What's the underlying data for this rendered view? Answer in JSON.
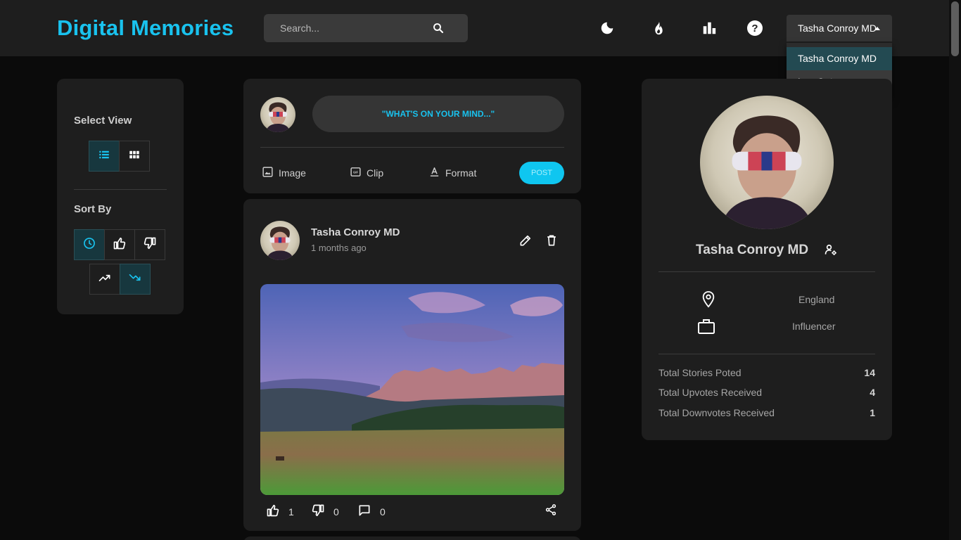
{
  "header": {
    "logo": "Digital Memories",
    "search_placeholder": "Search...",
    "icons": [
      "moon-icon",
      "fire-icon",
      "bar-chart-icon",
      "help-icon"
    ],
    "user_menu_label": "Tasha Conroy MD"
  },
  "dropdown": {
    "items": [
      {
        "label": "Tasha Conroy MD"
      },
      {
        "label": "Log Out"
      }
    ]
  },
  "sidebar": {
    "select_view_title": "Select View",
    "view_options": [
      "list-view-icon",
      "grid-view-icon"
    ],
    "sort_by_title": "Sort By",
    "sort_options": [
      "clock-icon",
      "thumbs-up-icon",
      "thumbs-down-icon",
      "trending-up-icon",
      "trending-down-icon"
    ]
  },
  "composer": {
    "prompt": "\"WHAT'S ON YOUR MIND...\"",
    "tools": [
      {
        "label": "Image",
        "icon": "image-icon"
      },
      {
        "label": "Clip",
        "icon": "gif-icon"
      },
      {
        "label": "Format",
        "icon": "text-format-icon"
      }
    ],
    "post_label": "POST"
  },
  "post": {
    "author": "Tasha Conroy MD",
    "time": "1 months ago",
    "upvotes": "1",
    "downvotes": "0",
    "comments": "0"
  },
  "profile": {
    "name": "Tasha Conroy MD",
    "location": "England",
    "occupation": "Influencer",
    "stats": [
      {
        "label": "Total Stories Poted",
        "value": "14"
      },
      {
        "label": "Total Upvotes Received",
        "value": "4"
      },
      {
        "label": "Total Downvotes Received",
        "value": "1"
      }
    ]
  },
  "colors": {
    "accent": "#19c2ee",
    "background": "#0b0b0b",
    "card": "#1e1e1e"
  }
}
